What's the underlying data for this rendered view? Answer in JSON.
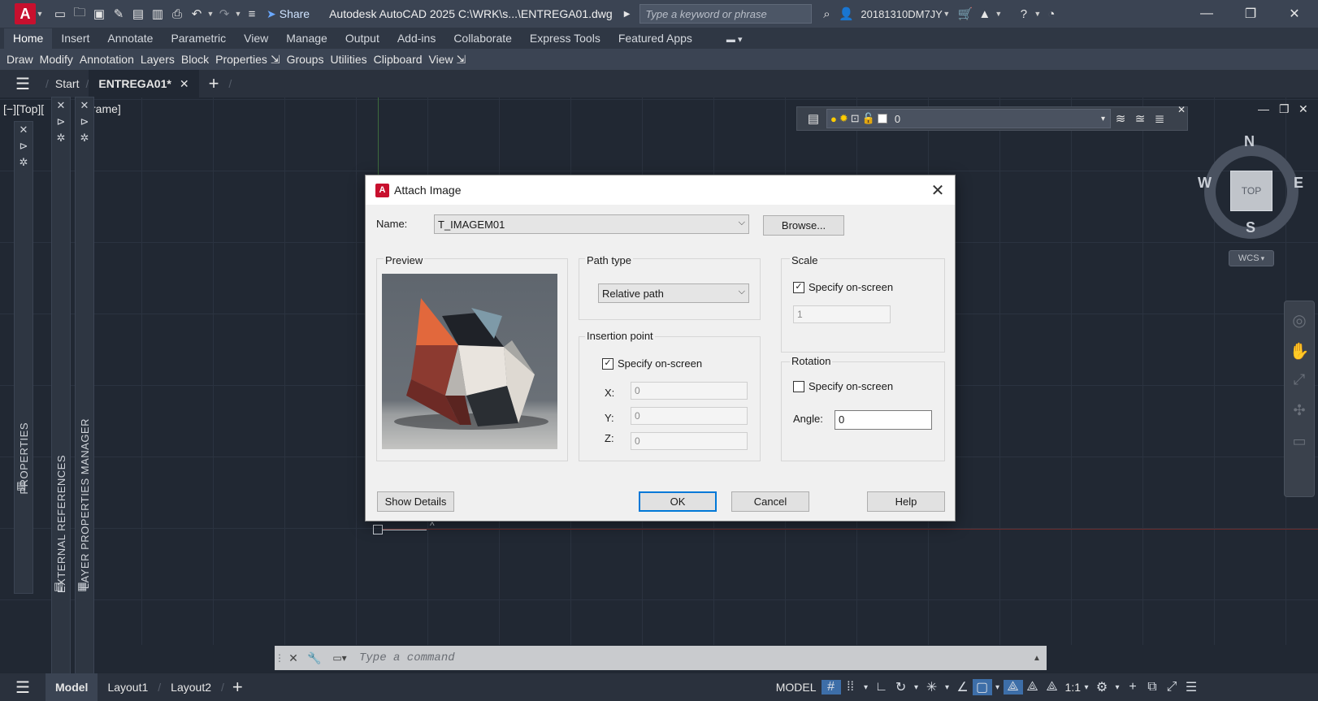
{
  "titlebar": {
    "app_logo": "A",
    "share_label": "Share",
    "title": "Autodesk AutoCAD 2025    C:\\WRK\\s...\\ENTREGA01.dwg",
    "search_placeholder": "Type a keyword or phrase",
    "user_name": "20181310DM7JY"
  },
  "ribbon": {
    "tabs": [
      "Home",
      "Insert",
      "Annotate",
      "Parametric",
      "View",
      "Manage",
      "Output",
      "Add-ins",
      "Collaborate",
      "Express Tools",
      "Featured Apps"
    ],
    "panels": [
      "Draw",
      "Modify",
      "Annotation",
      "Layers",
      "Block",
      "Properties ⇲",
      "Groups",
      "Utilities",
      "Clipboard",
      "View ⇲"
    ]
  },
  "filetabs": {
    "start": "Start",
    "active": "ENTREGA01*"
  },
  "viewport": {
    "label": "[−][Top][",
    "label_tail": "rame]"
  },
  "palettes": {
    "properties": "PROPERTIES",
    "xrefs": "EXTERNAL REFERENCES",
    "layer_manager": "LAYER PROPERTIES MANAGER"
  },
  "layer_toolbar": {
    "current_layer": "0"
  },
  "viewcube": {
    "n": "N",
    "s": "S",
    "e": "E",
    "w": "W",
    "face": "TOP",
    "wcs": "WCS"
  },
  "dialog": {
    "title": "Attach Image",
    "name_label": "Name:",
    "name_value": "T_IMAGEM01",
    "browse": "Browse...",
    "preview_label": "Preview",
    "path_type_label": "Path type",
    "path_type_value": "Relative path",
    "insertion_label": "Insertion point",
    "insertion_specify": "Specify on-screen",
    "insertion_checked": true,
    "x_label": "X:",
    "x_value": "0",
    "y_label": "Y:",
    "y_value": "0",
    "z_label": "Z:",
    "z_value": "0",
    "scale_label": "Scale",
    "scale_specify": "Specify on-screen",
    "scale_checked": true,
    "scale_value": "1",
    "rotation_label": "Rotation",
    "rotation_specify": "Specify on-screen",
    "rotation_checked": false,
    "angle_label": "Angle:",
    "angle_value": "0",
    "show_details": "Show Details",
    "ok": "OK",
    "cancel": "Cancel",
    "help": "Help"
  },
  "commandline": {
    "placeholder": "Type a command"
  },
  "statusbar": {
    "model_tab": "Model",
    "layout1": "Layout1",
    "layout2": "Layout2",
    "space": "MODEL",
    "scale": "1:1"
  },
  "colors": {
    "accent": "#0078d7",
    "autocad_red": "#c8102e",
    "preview_orange": "#e2683c",
    "preview_red": "#8c3a30"
  }
}
